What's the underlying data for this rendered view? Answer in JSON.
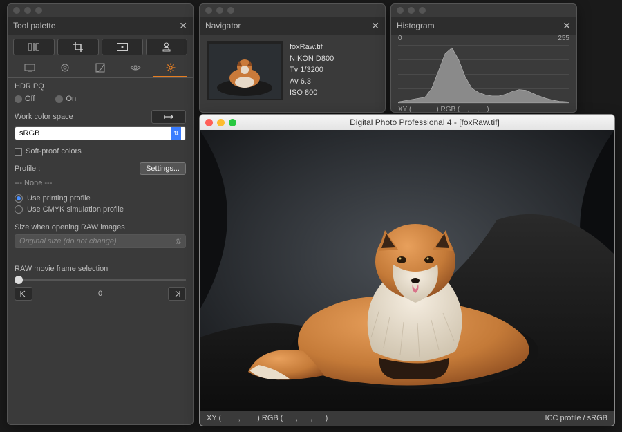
{
  "tool_palette": {
    "title": "Tool palette",
    "hdr_pq_label": "HDR PQ",
    "hdr_off": "Off",
    "hdr_on": "On",
    "work_color_space_label": "Work color space",
    "work_color_space_value": "sRGB",
    "soft_proof_label": "Soft-proof colors",
    "profile_label": "Profile :",
    "settings_btn": "Settings...",
    "profile_none": "---   None   ---",
    "use_printing_profile": "Use printing profile",
    "use_cmyk_profile": "Use CMYK simulation profile",
    "size_raw_label": "Size when opening RAW images",
    "size_raw_value": "Original size (do not change)",
    "raw_movie_label": "RAW movie frame selection",
    "frame_value": "0"
  },
  "navigator": {
    "title": "Navigator",
    "filename": "foxRaw.tif",
    "camera": "NIKON D800",
    "shutter": "Tv 1/3200",
    "aperture": "Av 6.3",
    "iso": "ISO 800"
  },
  "histogram": {
    "title": "Histogram",
    "min": "0",
    "max": "255",
    "xy_label": "XY (",
    "rgb_label": ")   RGB (",
    "close_paren": ")",
    "commas": ","
  },
  "image_window": {
    "title": "Digital Photo Professional 4 - [foxRaw.tif]",
    "status_xy": "XY (",
    "status_rgb": ")     RGB (",
    "status_close": ")",
    "icc_label": "ICC profile / sRGB",
    "comma": ","
  },
  "chart_data": {
    "type": "area",
    "title": "Histogram",
    "xlabel": "",
    "ylabel": "",
    "xlim": [
      0,
      255
    ],
    "ylim": [
      0,
      100
    ],
    "x": [
      0,
      10,
      20,
      30,
      40,
      50,
      60,
      70,
      80,
      90,
      100,
      110,
      120,
      130,
      140,
      150,
      160,
      170,
      180,
      190,
      200,
      210,
      220,
      230,
      240,
      255
    ],
    "values": [
      2,
      4,
      6,
      8,
      10,
      25,
      55,
      85,
      95,
      75,
      45,
      25,
      18,
      14,
      12,
      12,
      15,
      20,
      23,
      22,
      17,
      12,
      8,
      5,
      3,
      2
    ]
  }
}
